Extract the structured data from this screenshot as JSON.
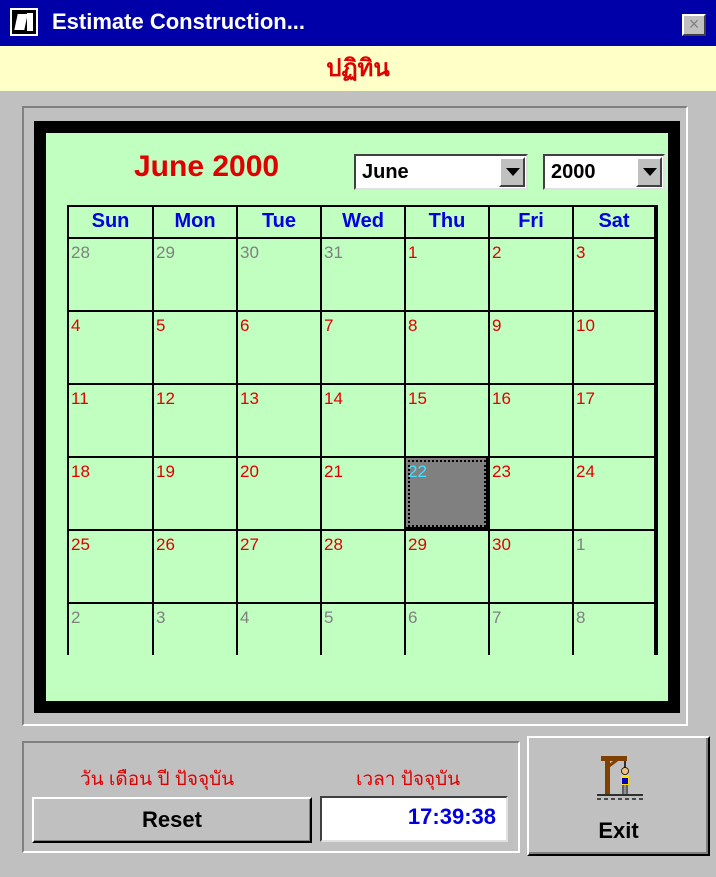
{
  "window": {
    "title": "Estimate Construction...",
    "icon": "app-icon",
    "close_icon": "close-icon"
  },
  "banner": {
    "text": "ปฏิทิน"
  },
  "calendar": {
    "title": "June 2000",
    "month_select": {
      "selected": "June"
    },
    "year_select": {
      "selected": "2000"
    },
    "weekdays": [
      "Sun",
      "Mon",
      "Tue",
      "Wed",
      "Thu",
      "Fri",
      "Sat"
    ],
    "weeks": [
      [
        {
          "d": "28",
          "m": "other"
        },
        {
          "d": "29",
          "m": "other"
        },
        {
          "d": "30",
          "m": "other"
        },
        {
          "d": "31",
          "m": "other"
        },
        {
          "d": "1",
          "m": "cur"
        },
        {
          "d": "2",
          "m": "cur"
        },
        {
          "d": "3",
          "m": "cur"
        }
      ],
      [
        {
          "d": "4",
          "m": "cur"
        },
        {
          "d": "5",
          "m": "cur"
        },
        {
          "d": "6",
          "m": "cur"
        },
        {
          "d": "7",
          "m": "cur"
        },
        {
          "d": "8",
          "m": "cur"
        },
        {
          "d": "9",
          "m": "cur"
        },
        {
          "d": "10",
          "m": "cur"
        }
      ],
      [
        {
          "d": "11",
          "m": "cur"
        },
        {
          "d": "12",
          "m": "cur"
        },
        {
          "d": "13",
          "m": "cur"
        },
        {
          "d": "14",
          "m": "cur"
        },
        {
          "d": "15",
          "m": "cur"
        },
        {
          "d": "16",
          "m": "cur"
        },
        {
          "d": "17",
          "m": "cur"
        }
      ],
      [
        {
          "d": "18",
          "m": "cur"
        },
        {
          "d": "19",
          "m": "cur"
        },
        {
          "d": "20",
          "m": "cur"
        },
        {
          "d": "21",
          "m": "cur"
        },
        {
          "d": "22",
          "m": "today"
        },
        {
          "d": "23",
          "m": "cur"
        },
        {
          "d": "24",
          "m": "cur"
        }
      ],
      [
        {
          "d": "25",
          "m": "cur"
        },
        {
          "d": "26",
          "m": "cur"
        },
        {
          "d": "27",
          "m": "cur"
        },
        {
          "d": "28",
          "m": "cur"
        },
        {
          "d": "29",
          "m": "cur"
        },
        {
          "d": "30",
          "m": "cur"
        },
        {
          "d": "1",
          "m": "other"
        }
      ],
      [
        {
          "d": "2",
          "m": "other"
        },
        {
          "d": "3",
          "m": "other"
        },
        {
          "d": "4",
          "m": "other"
        },
        {
          "d": "5",
          "m": "other"
        },
        {
          "d": "6",
          "m": "other"
        },
        {
          "d": "7",
          "m": "other"
        },
        {
          "d": "8",
          "m": "other"
        }
      ]
    ],
    "colors": {
      "background": "#c0ffc0",
      "current_month_day": "#e00000",
      "other_month_day": "#808080",
      "weekday_header": "#0000e0",
      "selected_day_bg": "#808080",
      "selected_day_text": "#40e0ff"
    }
  },
  "footer": {
    "date_label": "วัน เดือน ปี ปัจจุบัน",
    "time_label": "เวลา ปัจจุบัน",
    "reset_label": "Reset",
    "time_value": "17:39:38",
    "exit_label": "Exit",
    "exit_icon": "gallows-exit-icon"
  }
}
